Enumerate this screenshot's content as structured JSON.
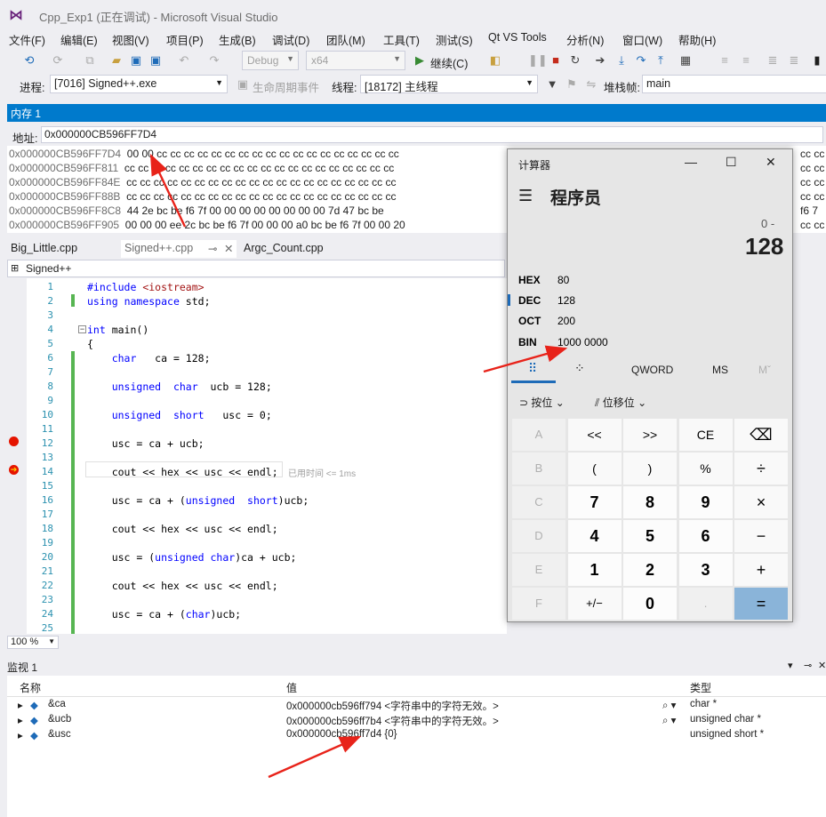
{
  "window": {
    "title": "Cpp_Exp1 (正在调试) - Microsoft Visual Studio"
  },
  "menu": [
    "文件(F)",
    "编辑(E)",
    "视图(V)",
    "项目(P)",
    "生成(B)",
    "调试(D)",
    "团队(M)",
    "工具(T)",
    "测试(S)",
    "Qt VS Tools",
    "分析(N)",
    "窗口(W)",
    "帮助(H)"
  ],
  "toolbar": {
    "config": "Debug",
    "platform": "x64",
    "continue": "继续(C)"
  },
  "debugbar": {
    "process_label": "进程:",
    "process": "[7016] Signed++.exe",
    "lifecycle": "生命周期事件",
    "thread_label": "线程:",
    "thread": "[18172] 主线程",
    "stack_label": "堆栈帧:",
    "stack": "main"
  },
  "memory": {
    "title": "内存 1",
    "addr_label": "地址:",
    "addr": "0x000000CB596FF7D4",
    "rows": [
      {
        "addr": "0x000000CB596FF7D4",
        "bytes": "00 00 cc cc cc cc cc cc cc cc cc cc cc cc cc cc cc cc cc cc"
      },
      {
        "addr": "0x000000CB596FF811",
        "bytes": "cc cc cc cc cc cc cc cc cc cc cc cc cc cc cc cc cc cc cc cc"
      },
      {
        "addr": "0x000000CB596FF84E",
        "bytes": "cc cc cc cc cc cc cc cc cc cc cc cc cc cc cc cc cc cc cc cc"
      },
      {
        "addr": "0x000000CB596FF88B",
        "bytes": "cc cc cc cc cc cc cc cc cc cc cc cc cc cc cc cc cc cc cc cc"
      },
      {
        "addr": "0x000000CB596FF8C8",
        "bytes": "44 2e bc be f6 7f 00 00 00 00 00 00 00 00 7d 47 bc be"
      },
      {
        "addr": "0x000000CB596FF905",
        "bytes": "00 00 00 ee 2c bc be f6 7f 00 00 00 a0 bc be f6 7f 00 00 20"
      }
    ],
    "right_edge": [
      [
        "cc",
        "cc"
      ],
      [
        "cc",
        "cc"
      ],
      [
        "cc",
        "cc"
      ],
      [
        "cc",
        "cc"
      ],
      [
        "f6",
        "7"
      ],
      [
        "cc",
        "cc"
      ]
    ]
  },
  "editor": {
    "tabs": [
      "Big_Little.cpp",
      "Signed++.cpp",
      "Argc_Count.cpp"
    ],
    "scope": "Signed++",
    "zoom": "100 %",
    "elapsed": "已用时间 <= 1ms",
    "lines": [
      {
        "n": "1",
        "t": "#include <iostream>"
      },
      {
        "n": "2",
        "t": "using namespace std;"
      },
      {
        "n": "3",
        "t": ""
      },
      {
        "n": "4",
        "t": "int main()"
      },
      {
        "n": "5",
        "t": "{"
      },
      {
        "n": "6",
        "t": "    char   ca = 128;"
      },
      {
        "n": "7",
        "t": ""
      },
      {
        "n": "8",
        "t": "    unsigned  char  ucb = 128;"
      },
      {
        "n": "9",
        "t": ""
      },
      {
        "n": "10",
        "t": "    unsigned  short   usc = 0;"
      },
      {
        "n": "11",
        "t": ""
      },
      {
        "n": "12",
        "t": "    usc = ca + ucb;"
      },
      {
        "n": "13",
        "t": ""
      },
      {
        "n": "14",
        "t": "    cout << hex << usc << endl;"
      },
      {
        "n": "15",
        "t": ""
      },
      {
        "n": "16",
        "t": "    usc = ca + (unsigned  short)ucb;"
      },
      {
        "n": "17",
        "t": ""
      },
      {
        "n": "18",
        "t": "    cout << hex << usc << endl;"
      },
      {
        "n": "19",
        "t": ""
      },
      {
        "n": "20",
        "t": "    usc = (unsigned char)ca + ucb;"
      },
      {
        "n": "21",
        "t": ""
      },
      {
        "n": "22",
        "t": "    cout << hex << usc << endl;"
      },
      {
        "n": "23",
        "t": ""
      },
      {
        "n": "24",
        "t": "    usc = ca + (char)ucb;"
      },
      {
        "n": "25",
        "t": ""
      }
    ]
  },
  "watch": {
    "title": "监视 1",
    "headers": {
      "name": "名称",
      "value": "值",
      "type": "类型"
    },
    "rows": [
      {
        "name": "&ca",
        "value": "0x000000cb596ff794 <字符串中的字符无效。>",
        "type": "char *"
      },
      {
        "name": "&ucb",
        "value": "0x000000cb596ff7b4 <字符串中的字符无效。>",
        "type": "unsigned char *"
      },
      {
        "name": "&usc",
        "value": "0x000000cb596ff7d4 {0}",
        "type": "unsigned short *"
      }
    ]
  },
  "calculator": {
    "title": "计算器",
    "mode": "程序员",
    "expression": "0 -",
    "display": "128",
    "radix": [
      {
        "label": "HEX",
        "value": "80"
      },
      {
        "label": "DEC",
        "value": "128"
      },
      {
        "label": "OCT",
        "value": "200"
      },
      {
        "label": "BIN",
        "value": "1000 0000"
      }
    ],
    "word": "QWORD",
    "ms": "MS",
    "mplus": "Mˇ",
    "bitwise": "按位",
    "shift": "位移位",
    "keys": [
      [
        "A",
        "<<",
        ">>",
        "CE",
        "⌫"
      ],
      [
        "B",
        "(",
        ")",
        "%",
        "÷"
      ],
      [
        "C",
        "7",
        "8",
        "9",
        "×"
      ],
      [
        "D",
        "4",
        "5",
        "6",
        "−"
      ],
      [
        "E",
        "1",
        "2",
        "3",
        "+"
      ],
      [
        "F",
        "+/−",
        "0",
        ".",
        "="
      ]
    ]
  }
}
